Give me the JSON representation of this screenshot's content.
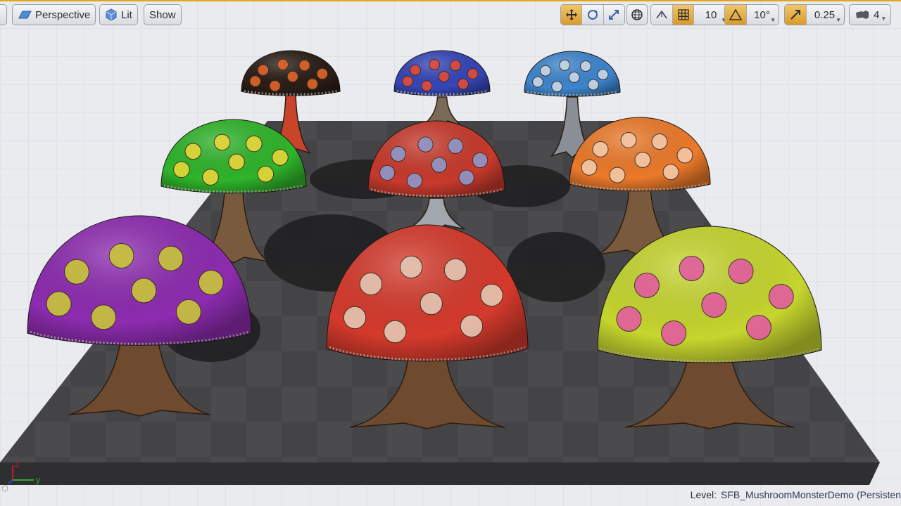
{
  "toolbar": {
    "view_mode_label": "Perspective",
    "lighting_label": "Lit",
    "show_label": "Show",
    "grid_snap_value": "10",
    "rotation_snap_value": "10°",
    "scale_snap_value": "0.25",
    "camera_speed_value": "4"
  },
  "status": {
    "level_prefix": "Level:",
    "level_name": "SFB_MushroomMonsterDemo (Persisten"
  },
  "gizmo": {
    "axis_z": "z",
    "axis_y": "y",
    "color_z": "#c0202a",
    "color_y": "#2faa2f",
    "color_x": "#2850d0"
  },
  "colors": {
    "accent": "#e6a317",
    "active_tool": "#d99a2a",
    "background": "#e9ebef",
    "floor": "#4a4a4c"
  },
  "mushrooms": [
    {
      "name": "brown-mushroom",
      "cap": "#2b1e17",
      "spot": "#e0662a",
      "stem": "#c8442a"
    },
    {
      "name": "blue-mushroom",
      "cap": "#3546b8",
      "spot": "#e24b3a",
      "stem": "#7a6b59"
    },
    {
      "name": "light-blue-mushroom",
      "cap": "#3d86cf",
      "spot": "#c9d7e6",
      "stem": "#8a8f97"
    },
    {
      "name": "green-mushroom",
      "cap": "#2fb52a",
      "spot": "#e8d63a",
      "stem": "#7a5a3c"
    },
    {
      "name": "red-spotted-mushroom-back",
      "cap": "#c83a2c",
      "spot": "#8f97c9",
      "stem": "#a2a7ad"
    },
    {
      "name": "orange-mushroom",
      "cap": "#ec7a2a",
      "spot": "#f2c9a8",
      "stem": "#7a5a3c"
    },
    {
      "name": "purple-mushroom",
      "cap": "#8d2cb0",
      "spot": "#c9c63a",
      "stem": "#6e4a2e"
    },
    {
      "name": "red-mushroom-front",
      "cap": "#d53a2c",
      "spot": "#e3c7b3",
      "stem": "#6e4a2e"
    },
    {
      "name": "yellow-green-mushroom",
      "cap": "#c6d62e",
      "spot": "#e25ca0",
      "stem": "#6e4a2e"
    }
  ]
}
